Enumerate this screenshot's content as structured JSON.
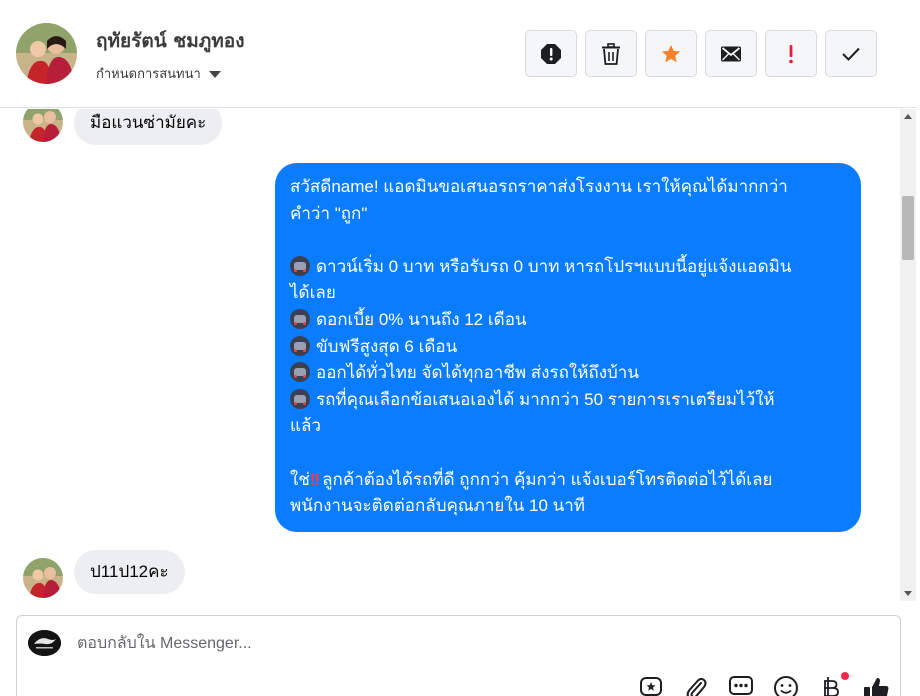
{
  "header": {
    "contact_name": "ฤทัยรัตน์ ชมภูทอง",
    "assign_label": "กำหนดการสนทนา",
    "actions": [
      {
        "name": "mark-spam-button",
        "icon": "exclamation-circle-icon"
      },
      {
        "name": "delete-button",
        "icon": "trash-icon"
      },
      {
        "name": "star-button",
        "icon": "star-icon",
        "color": "#f5822a"
      },
      {
        "name": "mark-unread-button",
        "icon": "envelope-icon"
      },
      {
        "name": "follow-up-button",
        "icon": "exclamation-icon",
        "color": "#e41e3f"
      },
      {
        "name": "mark-done-button",
        "icon": "checkmark-icon"
      }
    ]
  },
  "messages": {
    "incoming_1": "มือแวนซ่ามัยคะ",
    "outgoing": {
      "line_1": "สวัสดีname! แอดมินขอเสนอรถราคาส่งโรงงาน เราให้คุณได้มากกว่า",
      "line_2": "คำว่า \"ถูก\"",
      "bullet_1a": "ดาวน์เริ่ม 0 บาท หรือรับรถ 0 บาท หารถโปรฯแบบนี้อยู่แจ้งแอดมิน",
      "bullet_1b": "ได้เลย",
      "bullet_2": "ดอกเบี้ย 0% นานถึง 12 เดือน",
      "bullet_3": "ขับฟรีสูงสุด 6 เดือน",
      "bullet_4": "ออกได้ทั่วไทย จัดได้ทุกอาชีพ ส่งรถให้ถึงบ้าน",
      "bullet_5a": "รถที่คุณเลือกข้อเสนอเองได้ มากกว่า 50 รายการเราเตรียมไว้ให้",
      "bullet_5b": "แล้ว",
      "closing_prefix": "ใช่",
      "closing_bang": "‼",
      "closing_1": "ลูกค้าต้องได้รถที่ดี ถูกกว่า คุ้มกว่า แจ้งเบอร์โทรติดต่อไว้ได้เลย",
      "closing_2": "พนักงานจะติดต่อกลับคุณภายใน 10 นาที"
    },
    "incoming_2": "ป11ป12คะ"
  },
  "composer": {
    "placeholder": "ตอบกลับใน Messenger...",
    "tools": [
      "saved-reply-icon",
      "paperclip-icon",
      "chat-dots-icon",
      "emoji-icon",
      "baht-icon",
      "thumbs-up-icon"
    ]
  },
  "colors": {
    "outgoing_bubble": "#0a7cff",
    "incoming_bubble": "#eceef0",
    "notification_dot": "#f0284a"
  }
}
